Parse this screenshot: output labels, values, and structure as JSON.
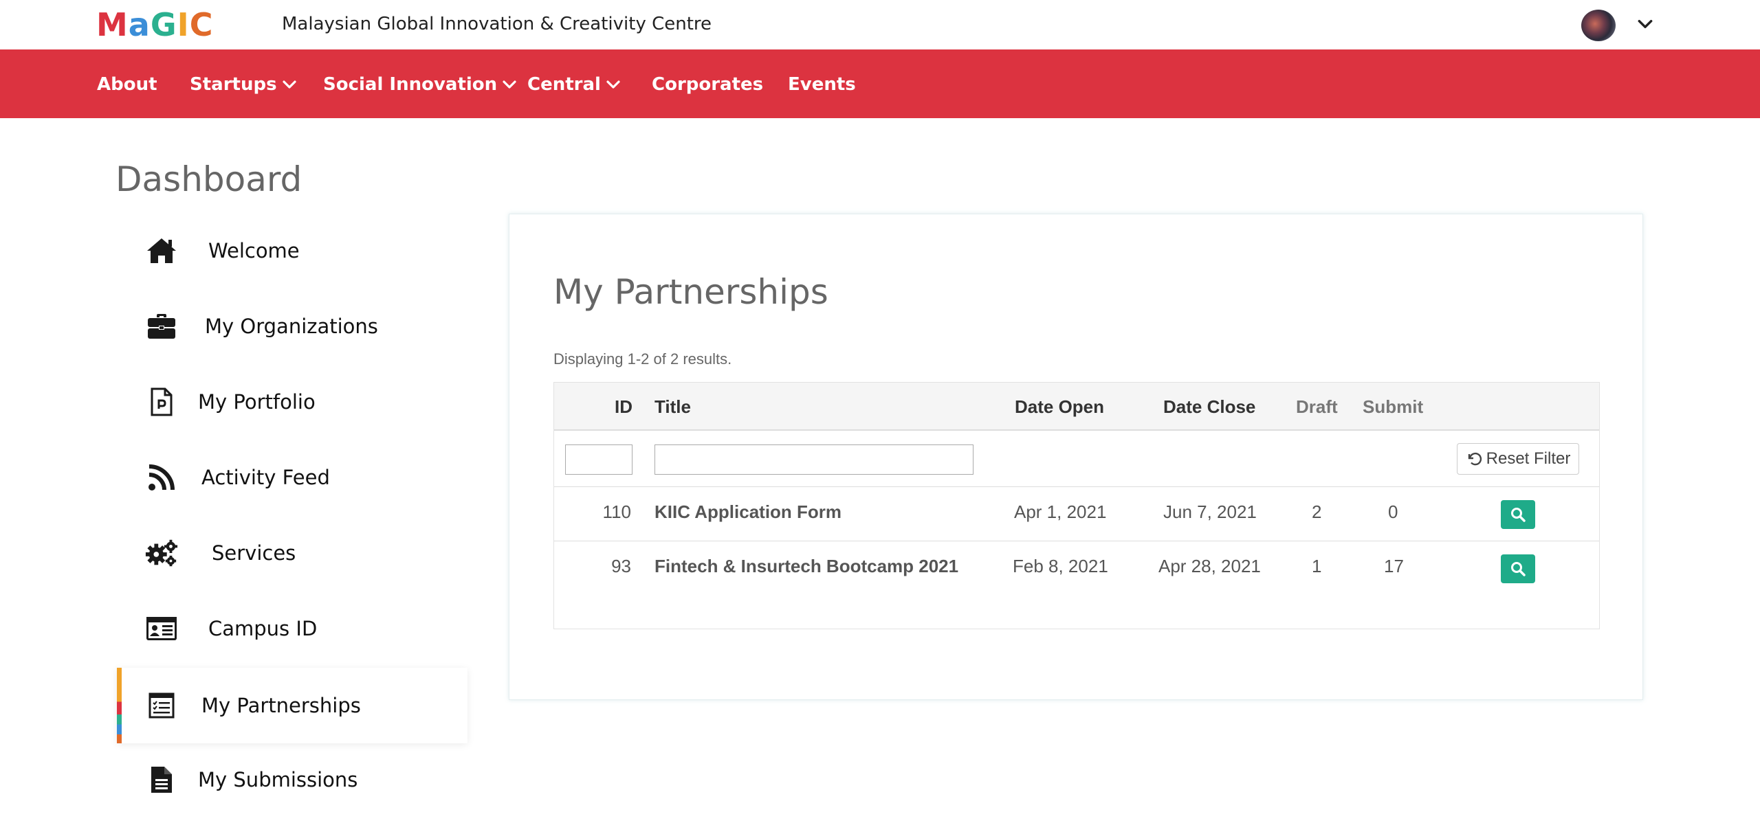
{
  "header": {
    "logo": {
      "letters": [
        "M",
        "a",
        "G",
        "I",
        "C"
      ],
      "colors": [
        "#dc3340",
        "#3b8ed8",
        "#2bb08f",
        "#f0a32a",
        "#e06a2a"
      ]
    },
    "site_title": "Malaysian Global Innovation & Creativity Centre"
  },
  "nav": {
    "background": "#dc3340",
    "items": [
      {
        "label": "About",
        "has_dropdown": false
      },
      {
        "label": "Startups",
        "has_dropdown": true
      },
      {
        "label": "Social Innovation",
        "has_dropdown": true
      },
      {
        "label": "Central",
        "has_dropdown": true
      },
      {
        "label": "Corporates",
        "has_dropdown": false
      },
      {
        "label": "Events",
        "has_dropdown": false
      }
    ]
  },
  "sidebar": {
    "title": "Dashboard",
    "items": [
      {
        "label": "Welcome",
        "icon": "home-icon"
      },
      {
        "label": "My Organizations",
        "icon": "briefcase-icon"
      },
      {
        "label": "My Portfolio",
        "icon": "portfolio-file-icon"
      },
      {
        "label": "Activity Feed",
        "icon": "rss-icon"
      },
      {
        "label": "Services",
        "icon": "gears-icon"
      },
      {
        "label": "Campus ID",
        "icon": "id-card-icon"
      },
      {
        "label": "My Partnerships",
        "icon": "checklist-icon",
        "active": true
      },
      {
        "label": "My Submissions",
        "icon": "document-icon"
      }
    ]
  },
  "main": {
    "title": "My Partnerships",
    "summary": "Displaying 1-2 of 2 results.",
    "columns": [
      "ID",
      "Title",
      "Date Open",
      "Date Close",
      "Draft",
      "Submit"
    ],
    "reset_filter_label": "Reset Filter",
    "rows": [
      {
        "id": "110",
        "title": "KIIC Application Form",
        "date_open": "Apr 1, 2021",
        "date_close": "Jun 7, 2021",
        "draft": "2",
        "submit": "0"
      },
      {
        "id": "93",
        "title": "Fintech & Insurtech Bootcamp 2021",
        "date_open": "Feb 8, 2021",
        "date_close": "Apr 28, 2021",
        "draft": "1",
        "submit": "17"
      }
    ],
    "action_color": "#1fab89"
  }
}
